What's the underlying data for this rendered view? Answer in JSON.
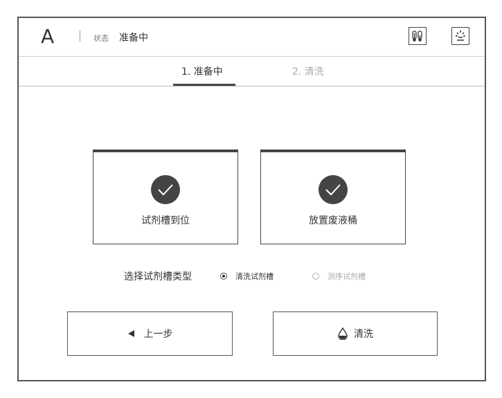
{
  "header": {
    "device_letter": "A",
    "status_label": "状态",
    "status_value": "准备中",
    "icons": [
      "thermometer-icon",
      "brightness-icon"
    ]
  },
  "tabs": [
    {
      "label": "1. 准备中",
      "active": true
    },
    {
      "label": "2. 清洗",
      "active": false
    }
  ],
  "cards": [
    {
      "label": "试剂槽到位",
      "icon": "check-icon"
    },
    {
      "label": "放置废液桶",
      "icon": "check-icon"
    }
  ],
  "selection": {
    "label": "选择试剂槽类型",
    "options": [
      {
        "label": "清洗试剂槽",
        "selected": true
      },
      {
        "label": "测序试剂槽",
        "selected": false
      }
    ]
  },
  "buttons": {
    "prev_label": "上一步",
    "prev_icon": "triangle-left-icon",
    "wash_label": "清洗",
    "wash_icon": "droplet-icon"
  },
  "colors": {
    "accent": "#444444",
    "inactive_text": "#aaaaaa",
    "border": "#555555"
  }
}
